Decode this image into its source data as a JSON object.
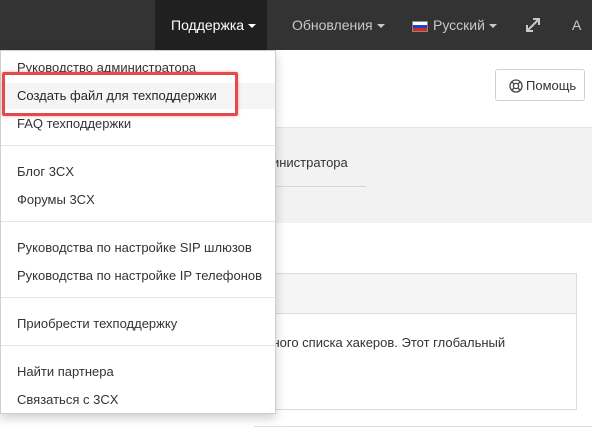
{
  "topbar": {
    "support_label": "Поддержка",
    "updates_label": "Обновления",
    "language_label": "Русский",
    "user_label": "A"
  },
  "header": {
    "help_label": "Помощь"
  },
  "tabs": {
    "active_label": "министратора"
  },
  "panel": {
    "text": "ерного списка хакеров. Этот глобальный"
  },
  "support_menu": {
    "groups": [
      [
        "Руководство администратора",
        "Создать файл для техподдержки",
        "FAQ техподдержки"
      ],
      [
        "Блог 3CX",
        "Форумы 3CX"
      ],
      [
        "Руководства по настройке SIP шлюзов",
        "Руководства по настройке IP телефонов"
      ],
      [
        "Приобрести техподдержку"
      ],
      [
        "Найти партнера",
        "Связаться с 3CX"
      ]
    ],
    "highlighted_item": "Создать файл для техподдержки"
  },
  "colors": {
    "topbar": "#333333",
    "topbar_active": "#202020",
    "highlight_box": "#e24b4b"
  }
}
